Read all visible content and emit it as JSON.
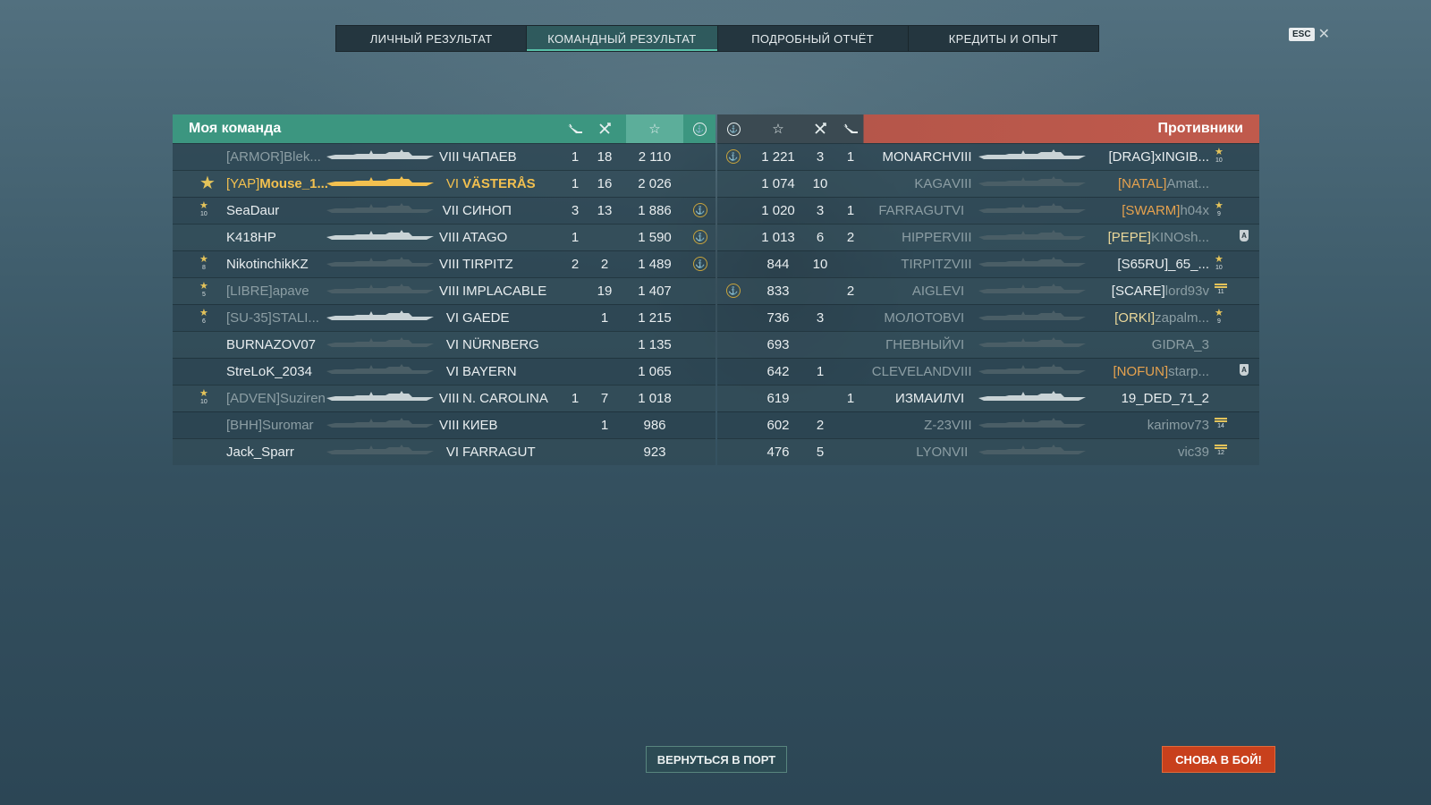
{
  "tabs": [
    {
      "label": "ЛИЧНЫЙ РЕЗУЛЬТАТ",
      "active": false
    },
    {
      "label": "КОМАНДНЫЙ РЕЗУЛЬТАТ",
      "active": true
    },
    {
      "label": "ПОДРОБНЫЙ ОТЧЁТ",
      "active": false
    },
    {
      "label": "КРЕДИТЫ И ОПЫТ",
      "active": false
    }
  ],
  "esc_label": "ESC",
  "my_team": {
    "title": "Моя команда",
    "players": [
      {
        "clan": "[ARMOR]",
        "name": "Blek...",
        "tier": "VIII",
        "ship": "ЧАПАЕВ",
        "c1": "1",
        "c2": "18",
        "xp": "2 110",
        "medal": "",
        "ach": false
      },
      {
        "clan": "[YAP]",
        "name": "Mouse_1...",
        "tier": "VI",
        "ship": "VÄSTERÅS",
        "c1": "1",
        "c2": "16",
        "xp": "2 026",
        "medal": "big-star",
        "ach": false,
        "self": true
      },
      {
        "clan": "",
        "name": "SeaDaur",
        "tier": "VII",
        "ship": "СИНОП",
        "c1": "3",
        "c2": "13",
        "xp": "1 886",
        "medal": "10",
        "ach": true
      },
      {
        "clan": "",
        "name": "K418HP",
        "tier": "VIII",
        "ship": "ATAGO",
        "c1": "1",
        "c2": "",
        "xp": "1 590",
        "medal": "",
        "ach": true
      },
      {
        "clan": "",
        "name": "NikotinchikKZ",
        "tier": "VIII",
        "ship": "TIRPITZ",
        "c1": "2",
        "c2": "2",
        "xp": "1 489",
        "medal": "8",
        "ach": true
      },
      {
        "clan": "[LIBRE]",
        "name": "apave",
        "tier": "VIII",
        "ship": "IMPLACABLE",
        "c1": "",
        "c2": "19",
        "xp": "1 407",
        "medal": "5",
        "ach": false
      },
      {
        "clan": "[SU-35]",
        "name": "STALI...",
        "tier": "VI",
        "ship": "GAEDE",
        "c1": "",
        "c2": "1",
        "xp": "1 215",
        "medal": "6",
        "ach": false
      },
      {
        "clan": "",
        "name": "BURNAZOV07",
        "tier": "VI",
        "ship": "NÜRNBERG",
        "c1": "",
        "c2": "",
        "xp": "1 135",
        "medal": "",
        "ach": false
      },
      {
        "clan": "",
        "name": "StreLoK_2034",
        "tier": "VI",
        "ship": "BAYERN",
        "c1": "",
        "c2": "",
        "xp": "1 065",
        "medal": "",
        "ach": false
      },
      {
        "clan": "[ADVEN]",
        "name": "Suziren",
        "tier": "VIII",
        "ship": "N. CAROLINA",
        "c1": "1",
        "c2": "7",
        "xp": "1 018",
        "medal": "10",
        "ach": false
      },
      {
        "clan": "[BHH]",
        "name": "Suromar",
        "tier": "VIII",
        "ship": "КИЕВ",
        "c1": "",
        "c2": "1",
        "xp": "986",
        "medal": "",
        "ach": false
      },
      {
        "clan": "",
        "name": "Jack_Sparr",
        "tier": "VI",
        "ship": "FARRAGUT",
        "c1": "",
        "c2": "",
        "xp": "923",
        "medal": "",
        "ach": false
      }
    ]
  },
  "enemies": {
    "title": "Противники",
    "players": [
      {
        "clan": "[DRAG]",
        "name": "xINGIB...",
        "tier": "VIII",
        "ship": "MONARCH",
        "c1": "1",
        "c2": "3",
        "xp": "1 221",
        "medal": "10",
        "ach": true
      },
      {
        "clan": "[NATAL]",
        "name": "Amat...",
        "tier": "VIII",
        "ship": "KAGA",
        "c1": "",
        "c2": "10",
        "xp": "1 074",
        "medal": "",
        "ach": false
      },
      {
        "clan": "[SWARM]",
        "name": "h04x",
        "tier": "VI",
        "ship": "FARRAGUT",
        "c1": "1",
        "c2": "3",
        "xp": "1 020",
        "medal": "9",
        "ach": false
      },
      {
        "clan": "[PEPE]",
        "name": "KINOsh...",
        "tier": "VIII",
        "ship": "HIPPER",
        "c1": "2",
        "c2": "6",
        "xp": "1 013",
        "medal": "",
        "ach": false,
        "badge": true
      },
      {
        "clan": "[S65RU]",
        "name": "_65_...",
        "tier": "VIII",
        "ship": "TIRPITZ",
        "c1": "",
        "c2": "10",
        "xp": "844",
        "medal": "10",
        "ach": false
      },
      {
        "clan": "[SCARE]",
        "name": "lord93v",
        "tier": "VI",
        "ship": "AIGLE",
        "c1": "2",
        "c2": "",
        "xp": "833",
        "medal": "",
        "ach": true,
        "stripe": "11"
      },
      {
        "clan": "[ORKI]",
        "name": "zapalm...",
        "tier": "VI",
        "ship": "МОЛОТОВ",
        "c1": "",
        "c2": "3",
        "xp": "736",
        "medal": "9",
        "ach": false
      },
      {
        "clan": "",
        "name": "GIDRA_3",
        "tier": "VI",
        "ship": "ГНЕВНЫЙ",
        "c1": "",
        "c2": "",
        "xp": "693",
        "medal": "",
        "ach": false
      },
      {
        "clan": "[NOFUN]",
        "name": "starp...",
        "tier": "VIII",
        "ship": "CLEVELAND",
        "c1": "",
        "c2": "1",
        "xp": "642",
        "medal": "",
        "ach": false,
        "badge": true
      },
      {
        "clan": "",
        "name": "19_DED_71_2",
        "tier": "VI",
        "ship": "ИЗМАИЛ",
        "c1": "1",
        "c2": "",
        "xp": "619",
        "medal": "",
        "ach": false
      },
      {
        "clan": "",
        "name": "karimov73",
        "tier": "VIII",
        "ship": "Z-23",
        "c1": "",
        "c2": "2",
        "xp": "602",
        "medal": "",
        "ach": false,
        "stripe": "14"
      },
      {
        "clan": "",
        "name": "vic39",
        "tier": "VII",
        "ship": "LYON",
        "c1": "",
        "c2": "5",
        "xp": "476",
        "medal": "",
        "ach": false,
        "stripe": "12"
      }
    ]
  },
  "buttons": {
    "port": "ВЕРНУТЬСЯ В ПОРТ",
    "battle": "СНОВА В БОЙ!"
  },
  "colors": {
    "my_team": "#3c9680",
    "enemy": "#c05a4c",
    "battle_button": "#c8401c",
    "self_highlight": "#f2c04f"
  }
}
